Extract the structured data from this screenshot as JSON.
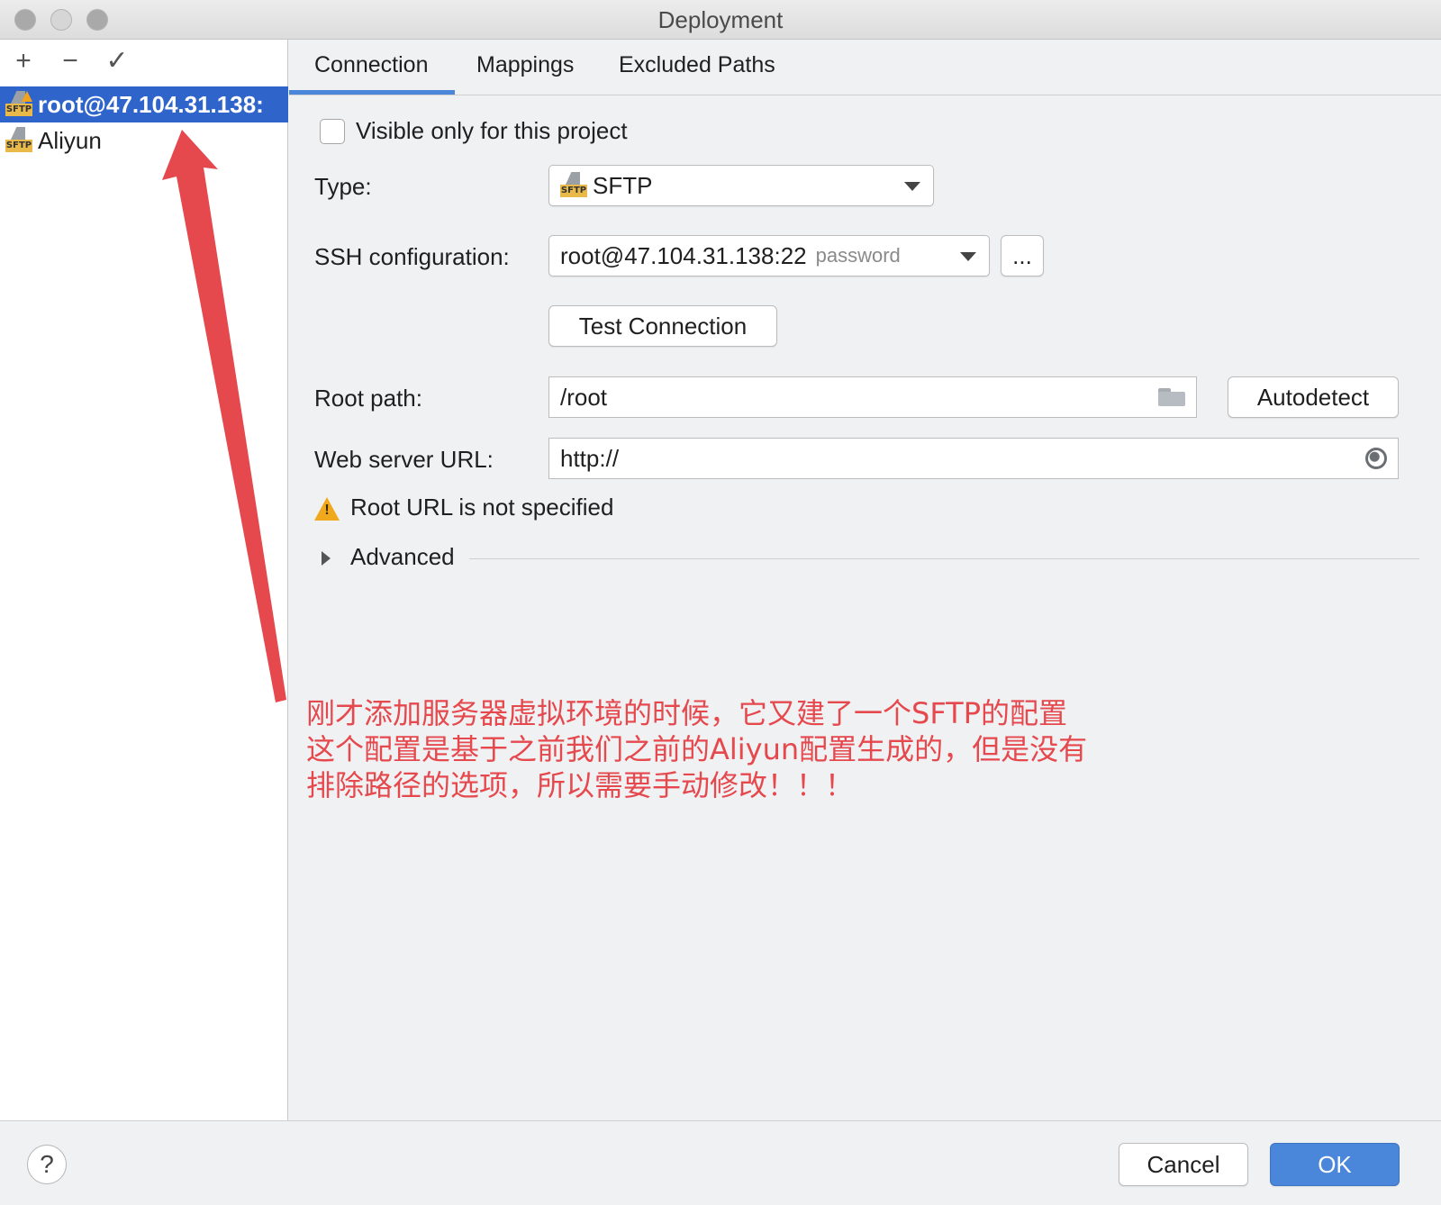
{
  "window": {
    "title": "Deployment"
  },
  "sidebar": {
    "toolbar": {
      "add": "+",
      "remove": "−",
      "apply": "✓"
    },
    "items": [
      {
        "label": "root@47.104.31.138:",
        "icon": "sftp-warning-icon",
        "selected": true
      },
      {
        "label": "Aliyun",
        "icon": "sftp-icon",
        "selected": false
      }
    ]
  },
  "tabs": [
    {
      "label": "Connection",
      "active": true
    },
    {
      "label": "Mappings",
      "active": false
    },
    {
      "label": "Excluded Paths",
      "active": false
    }
  ],
  "form": {
    "visible_only": {
      "label": "Visible only for this project",
      "checked": false
    },
    "type": {
      "label": "Type:",
      "value": "SFTP"
    },
    "ssh": {
      "label": "SSH configuration:",
      "value": "root@47.104.31.138:22",
      "hint": "password",
      "more": "..."
    },
    "test_connection": "Test Connection",
    "root_path": {
      "label": "Root path:",
      "value": "/root",
      "autodetect": "Autodetect"
    },
    "web_server": {
      "label": "Web server URL:",
      "value": "http://"
    },
    "warning": "Root URL is not specified",
    "advanced": "Advanced"
  },
  "annotation": {
    "color": "#e5484d",
    "lines": [
      "刚才添加服务器虚拟环境的时候，它又建了一个SFTP的配置",
      "这个配置是基于之前我们之前的Aliyun配置生成的，但是没有",
      "排除路径的选项，所以需要手动修改！！！"
    ]
  },
  "footer": {
    "help": "?",
    "cancel": "Cancel",
    "ok": "OK"
  },
  "colors": {
    "accent": "#4a86d9",
    "selection": "#2f65ca",
    "warning": "#f0a81c"
  }
}
